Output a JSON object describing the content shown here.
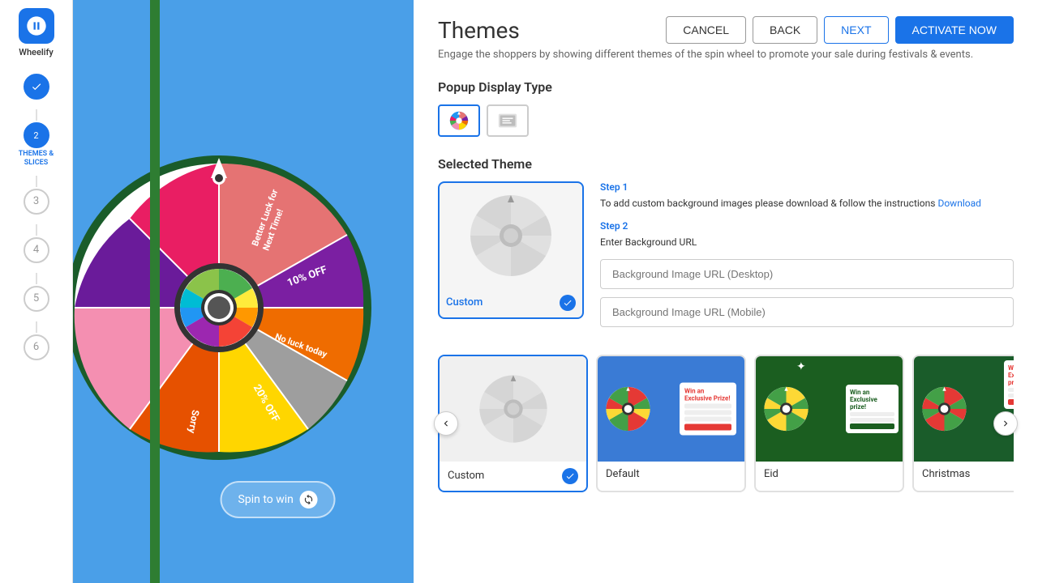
{
  "app": {
    "name": "Wheelify",
    "logo_alt": "Wheelify logo"
  },
  "header": {
    "title": "Themes",
    "subtitle": "Engage the shoppers by showing different themes of the spin wheel to promote your sale during festivals & events."
  },
  "buttons": {
    "cancel": "CANCEL",
    "back": "BACK",
    "next": "NEXT",
    "activate": "ACTIVATE NOW"
  },
  "steps": [
    {
      "number": "✓",
      "label": "",
      "state": "completed"
    },
    {
      "number": "2",
      "label": "THEMES & SLICES",
      "state": "active"
    },
    {
      "number": "3",
      "label": "",
      "state": "inactive"
    },
    {
      "number": "4",
      "label": "",
      "state": "inactive"
    },
    {
      "number": "5",
      "label": "",
      "state": "inactive"
    },
    {
      "number": "6",
      "label": "",
      "state": "inactive"
    }
  ],
  "popup_display": {
    "section_title": "Popup Display Type",
    "types": [
      {
        "id": "wheel",
        "selected": true
      },
      {
        "id": "scratch",
        "selected": false
      }
    ]
  },
  "selected_theme": {
    "section_title": "Selected Theme",
    "name": "Custom",
    "step1": {
      "label": "Step 1",
      "desc": "To add custom background images please download & follow the instructions",
      "download_text": "Download"
    },
    "step2": {
      "label": "Step 2",
      "desc": "Enter Background URL"
    },
    "desktop_url_placeholder": "Background Image URL (Desktop)",
    "mobile_url_placeholder": "Background Image URL (Mobile)"
  },
  "themes": [
    {
      "name": "Custom",
      "selected": true,
      "type": "custom"
    },
    {
      "name": "Default",
      "selected": false,
      "type": "default"
    },
    {
      "name": "Eid",
      "selected": false,
      "type": "eid"
    },
    {
      "name": "Christmas",
      "selected": false,
      "type": "christmas"
    }
  ],
  "spin_button": "Spin to win",
  "wheel_labels": [
    "Better Luck for Next Time!",
    "10% OFF",
    "No luck today",
    "20% OFF",
    "Sorry"
  ],
  "colors": {
    "primary": "#1a73e8",
    "wheel_bg": "#4a9fe8"
  }
}
